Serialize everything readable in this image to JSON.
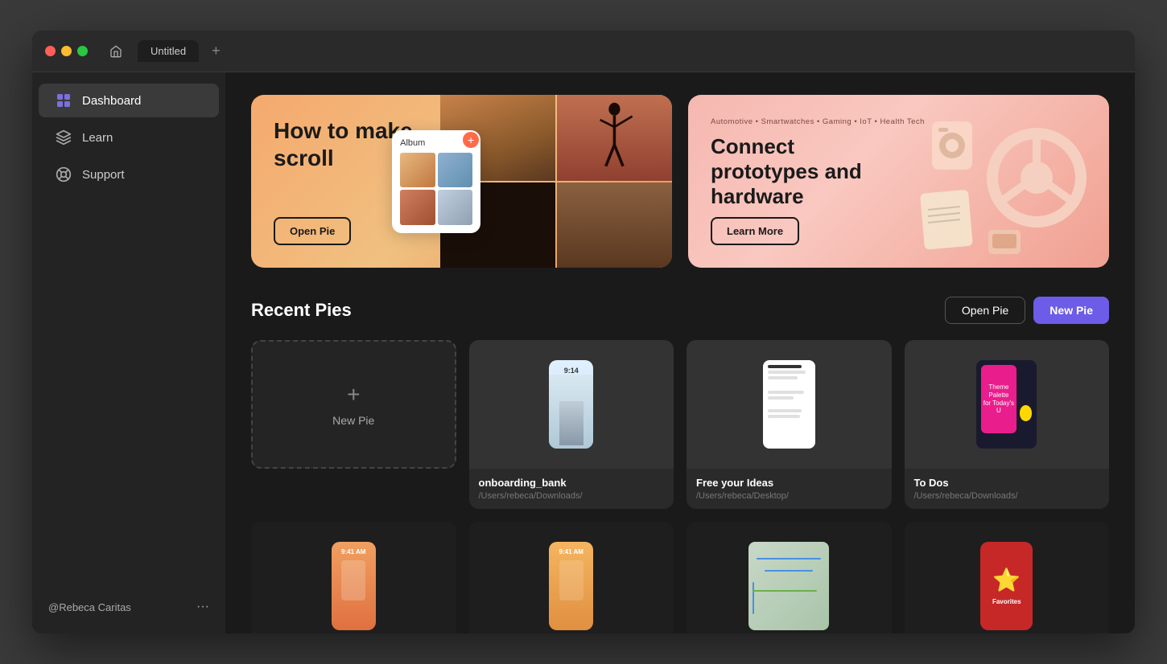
{
  "window": {
    "title": "Untitled",
    "tab_new_label": "+"
  },
  "sidebar": {
    "items": [
      {
        "id": "dashboard",
        "label": "Dashboard",
        "active": true
      },
      {
        "id": "learn",
        "label": "Learn",
        "active": false
      },
      {
        "id": "support",
        "label": "Support",
        "active": false
      }
    ],
    "user": {
      "name": "@Rebeca Caritas",
      "dots": "···"
    }
  },
  "banners": [
    {
      "id": "scroll-banner",
      "title": "How to make scroll",
      "button_label": "Open Pie",
      "images": [
        "desert",
        "tennis",
        "dark",
        "bottle"
      ],
      "album_label": "Album"
    },
    {
      "id": "hardware-banner",
      "categories": "Automotive • Smartwatches • Gaming • IoT • Health Tech",
      "title": "Connect prototypes and hardware",
      "button_label": "Learn More"
    }
  ],
  "recent_pies": {
    "section_title": "Recent Pies",
    "open_pie_label": "Open Pie",
    "new_pie_label": "New Pie",
    "cards": [
      {
        "id": "new-pie",
        "type": "new",
        "label": "New Pie"
      },
      {
        "id": "onboarding-bank",
        "type": "project",
        "name": "onboarding_bank",
        "path": "/Users/rebeca/Downloads/",
        "thumb_type": "phone-building"
      },
      {
        "id": "free-your-ideas",
        "type": "project",
        "name": "Free your Ideas",
        "path": "/Users/rebeca/Desktop/",
        "thumb_type": "white-doc"
      },
      {
        "id": "to-dos",
        "type": "project",
        "name": "To Dos",
        "path": "/Users/rebeca/Downloads/",
        "thumb_type": "colorful"
      }
    ],
    "second_row_cards": [
      {
        "id": "card-orange",
        "type": "project",
        "name": "",
        "path": "",
        "thumb_type": "orange-phone"
      },
      {
        "id": "card-orange2",
        "type": "project",
        "name": "",
        "path": "",
        "thumb_type": "orange-phone2"
      },
      {
        "id": "card-map",
        "type": "project",
        "name": "",
        "path": "",
        "thumb_type": "map"
      },
      {
        "id": "card-star",
        "type": "project",
        "name": "",
        "path": "",
        "thumb_type": "star-red"
      }
    ]
  }
}
